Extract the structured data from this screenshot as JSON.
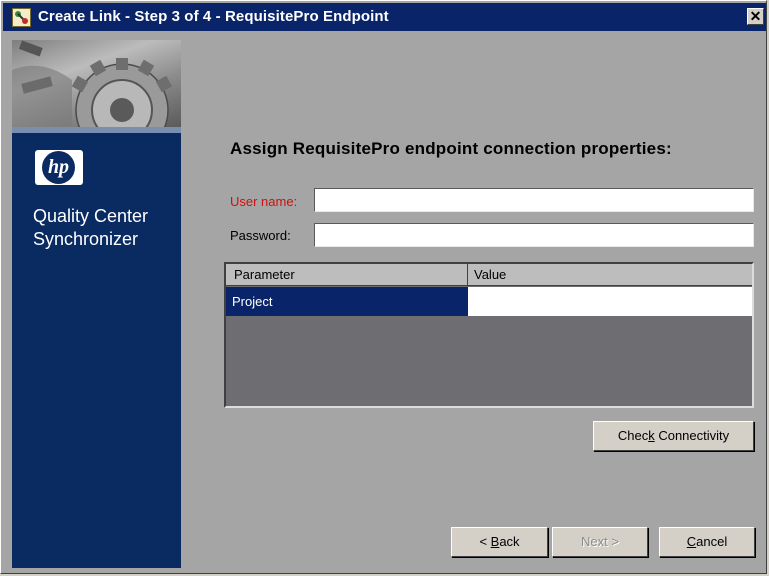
{
  "window": {
    "title": "Create Link - Step 3 of 4 - RequisitePro Endpoint",
    "close_glyph": "✕"
  },
  "sidebar": {
    "logo_text": "hp",
    "product_name": "Quality Center\nSynchronizer"
  },
  "main": {
    "heading": "Assign RequisitePro endpoint connection properties:",
    "username": {
      "label": "User name:",
      "value": ""
    },
    "password": {
      "label": "Password:",
      "value": ""
    },
    "grid": {
      "columns": [
        "Parameter",
        "Value"
      ],
      "rows": [
        {
          "parameter": "Project",
          "value": ""
        }
      ]
    },
    "check_connectivity": {
      "pre": "Chec",
      "accel": "k",
      "post": " Connectivity"
    }
  },
  "footer": {
    "back": {
      "pre": "< ",
      "accel": "B",
      "post": "ack"
    },
    "next": {
      "label": "Next >"
    },
    "cancel": {
      "accel": "C",
      "post": "ancel"
    }
  },
  "colors": {
    "title_bar": "#0a246a",
    "sidebar": "#0a2a62",
    "dialog_body": "#a5a5a5",
    "required_label": "#d01010",
    "selected_row": "#0a246a"
  },
  "icons": {
    "app": "synchronizer-app-icon",
    "close": "close-icon",
    "banner": "gear-image"
  }
}
